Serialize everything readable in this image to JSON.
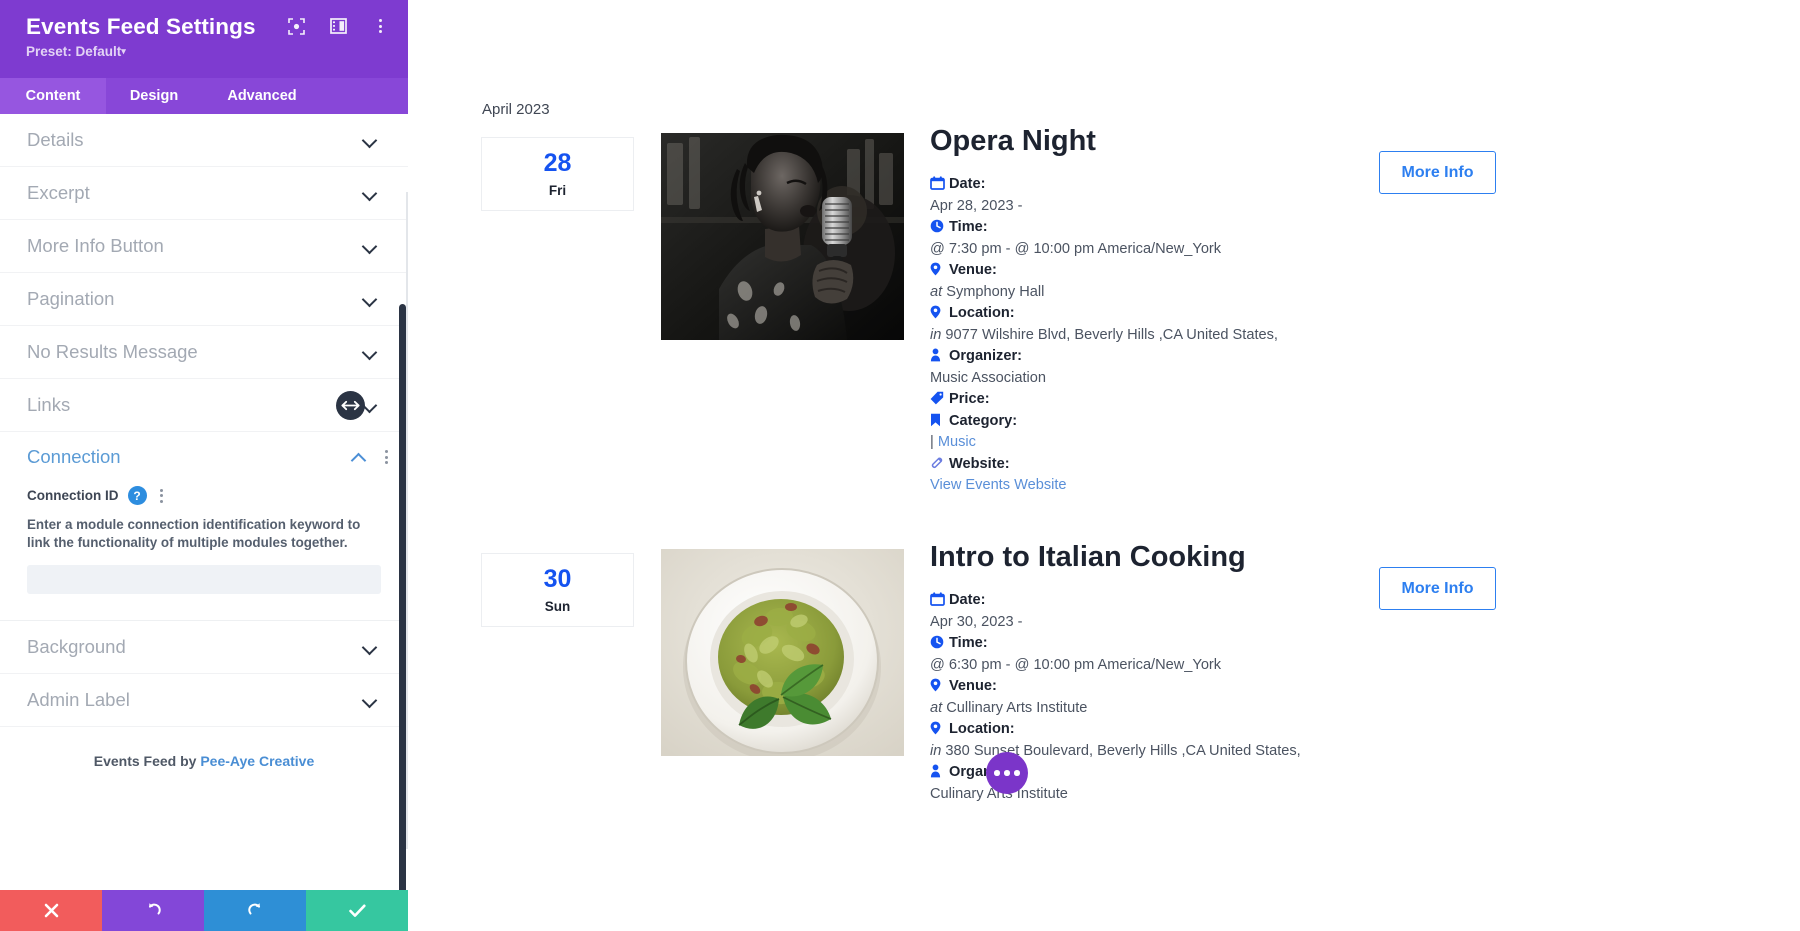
{
  "sidebar": {
    "title": "Events Feed Settings",
    "preset": "Preset: Default",
    "preset_caret": "▾",
    "header_icons": [
      {
        "name": "focus-target-icon"
      },
      {
        "name": "panel-layout-icon"
      },
      {
        "name": "overflow-menu-icon"
      }
    ],
    "tabs": [
      {
        "label": "Content",
        "active": true
      },
      {
        "label": "Design",
        "active": false
      },
      {
        "label": "Advanced",
        "active": false
      }
    ],
    "accordions": [
      {
        "label": "Details",
        "open": false
      },
      {
        "label": "Excerpt",
        "open": false
      },
      {
        "label": "More Info Button",
        "open": false
      },
      {
        "label": "Pagination",
        "open": false
      },
      {
        "label": "No Results Message",
        "open": false
      },
      {
        "label": "Links",
        "open": false
      },
      {
        "label": "Connection",
        "open": true
      },
      {
        "label": "Background",
        "open": false
      },
      {
        "label": "Admin Label",
        "open": false
      }
    ],
    "connection": {
      "field_label": "Connection ID",
      "help_badge": "?",
      "description": "Enter a module connection identification keyword to link the functionality of multiple modules together.",
      "input_value": "",
      "input_placeholder": ""
    },
    "credit_prefix": "Events Feed by ",
    "credit_link": "Pee-Aye Creative",
    "footer_buttons": [
      {
        "name": "cancel-button",
        "color": "#f25c5c"
      },
      {
        "name": "undo-button",
        "color": "#8347d8"
      },
      {
        "name": "redo-button",
        "color": "#2e8fd6"
      },
      {
        "name": "save-button",
        "color": "#36c7a0"
      }
    ]
  },
  "main": {
    "month_label": "April 2023",
    "more_info_label": "More Info",
    "labels": {
      "date": "Date:",
      "time": "Time:",
      "venue": "Venue:",
      "location": "Location:",
      "organizer": "Organizer:",
      "price": "Price:",
      "category": "Category:",
      "website": "Website:"
    },
    "events": [
      {
        "day": "28",
        "weekday": "Fri",
        "title": "Opera Night",
        "photo": "singer-with-microphone-bw",
        "date_value": "Apr 28, 2023 -",
        "time_value": "@ 7:30 pm - @ 10:00 pm America/New_York",
        "venue_prefix": "at",
        "venue_value": "Symphony Hall",
        "location_prefix": "in",
        "location_value": "9077 Wilshire Blvd, Beverly Hills ,CA United States,",
        "organizer_value": "Music Association",
        "price_value": "",
        "category_sep": "|",
        "category_value": "Music",
        "website_value": "View Events Website"
      },
      {
        "day": "30",
        "weekday": "Sun",
        "title": "Intro to Italian Cooking",
        "photo": "pesto-pasta-plate",
        "date_value": "Apr 30, 2023 -",
        "time_value": "@ 6:30 pm - @ 10:00 pm America/New_York",
        "venue_prefix": "at",
        "venue_value": "Cullinary Arts Institute",
        "location_prefix": "in",
        "location_value": "380 Sunset Boulevard, Beverly Hills ,CA United States,",
        "organizer_value": "",
        "price_value": "",
        "category_sep": "",
        "category_value": "",
        "website_value": "",
        "organizer_below": "Culinary Arts Institute"
      }
    ],
    "fab": {
      "name": "more-options-fab",
      "color": "#7b35c9"
    }
  },
  "colors": {
    "brand_purple": "#7e3bd0",
    "tab_purple": "#8847d8",
    "accent_blue": "#1553f0",
    "link_blue": "#5a8fd8",
    "button_blue": "#2d7ff0"
  }
}
